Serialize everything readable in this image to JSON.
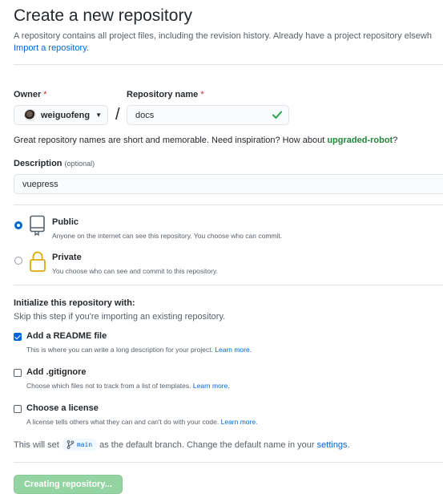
{
  "header": {
    "title": "Create a new repository",
    "description": "A repository contains all project files, including the revision history. Already have a project repository elsewh",
    "import_link": "Import a repository."
  },
  "owner": {
    "label": "Owner",
    "required_mark": "*",
    "value": "weiguofeng"
  },
  "repo_name": {
    "label": "Repository name",
    "required_mark": "*",
    "value": "docs",
    "separator": "/"
  },
  "hint": {
    "text": "Great repository names are short and memorable. Need inspiration? How about",
    "suggestion": "upgraded-robot",
    "suffix": "?"
  },
  "description_field": {
    "label": "Description",
    "optional": "(optional)",
    "value": "vuepress"
  },
  "visibility": {
    "public": {
      "title": "Public",
      "desc": "Anyone on the internet can see this repository. You choose who can commit.",
      "selected": true
    },
    "private": {
      "title": "Private",
      "desc": "You choose who can see and commit to this repository.",
      "selected": false
    }
  },
  "initialize": {
    "title": "Initialize this repository with:",
    "subtitle": "Skip this step if you're importing an existing repository.",
    "readme": {
      "title": "Add a README file",
      "desc": "This is where you can write a long description for your project.",
      "learn": "Learn more.",
      "checked": true
    },
    "gitignore": {
      "title": "Add .gitignore",
      "desc": "Choose which files not to track from a list of templates.",
      "learn": "Learn more.",
      "checked": false
    },
    "license": {
      "title": "Choose a license",
      "desc": "A license tells others what they can and can't do with your code.",
      "learn": "Learn more.",
      "checked": false
    }
  },
  "branch": {
    "prefix": "This will set",
    "name": "main",
    "middle": "as the default branch. Change the default name in your",
    "settings_link": "settings",
    "suffix": "."
  },
  "submit": {
    "label": "Creating repository..."
  },
  "colors": {
    "link": "#0366d6",
    "success": "#22863a",
    "button_disabled": "#94d3a2",
    "private_icon": "#dbab09"
  }
}
